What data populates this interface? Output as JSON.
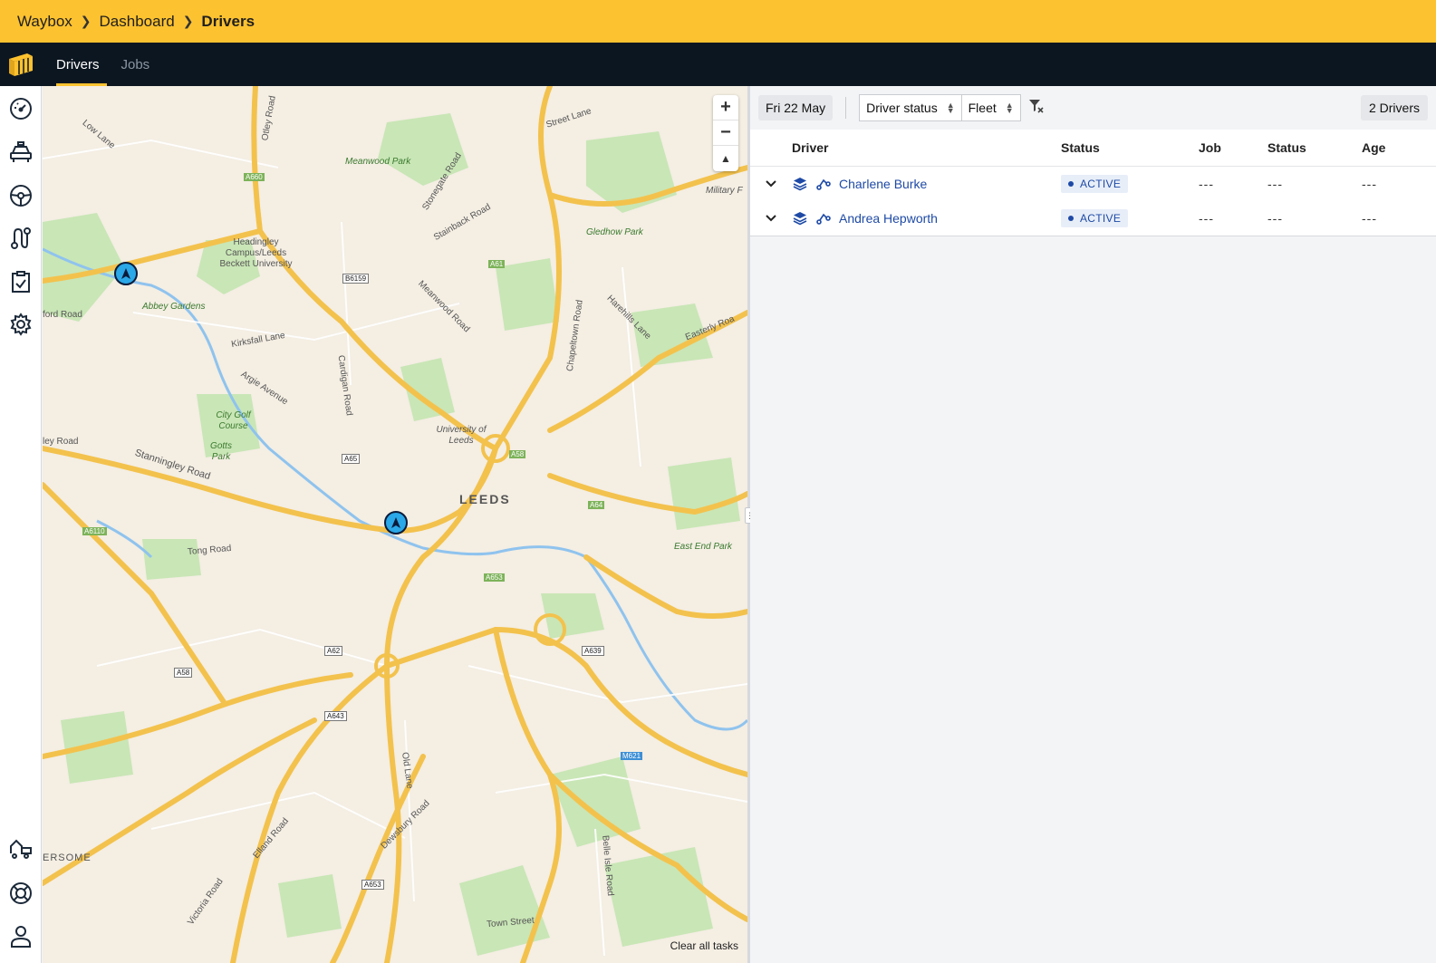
{
  "breadcrumb": {
    "items": [
      "Waybox",
      "Dashboard",
      "Drivers"
    ]
  },
  "nav": {
    "tabs": [
      {
        "label": "Drivers",
        "active": true
      },
      {
        "label": "Jobs",
        "active": false
      }
    ]
  },
  "sidebar": {
    "top_icons": [
      "speedometer-icon",
      "taxi-icon",
      "steering-wheel-icon",
      "route-icon",
      "clipboard-check-icon",
      "gear-icon"
    ],
    "bottom_icons": [
      "truck-icon",
      "lifebuoy-icon",
      "user-icon"
    ]
  },
  "map": {
    "zoom_in": "+",
    "zoom_out": "−",
    "compass": "▲",
    "clear_tasks": "Clear all tasks",
    "city_label": "LEEDS",
    "labels": {
      "otley_road": "Otley Road",
      "low_lane": "Low Lane",
      "street_lane": "Street Lane",
      "meanwood_park": "Meanwood Park",
      "stonegate_road": "Stonegate Road",
      "stainbeck_road": "Stainback Road",
      "military": "Military F",
      "gledhow_park": "Gledhow Park",
      "headingley": "Headingley Campus/Leeds Beckett University",
      "abbey_gardens": "Abbey Gardens",
      "ford_road": "ford Road",
      "kirksfall_lane": "Kirksfall Lane",
      "cardigan_road": "Cardigan Road",
      "meanwood_road": "Meanwood Road",
      "chapeltown_road": "Chapeltown Road",
      "harehills_lane": "Harehills Lane",
      "easterly_road": "Easterly Roa",
      "argie_avenue": "Argie Avenue",
      "city_golf": "City Golf Course",
      "university": "University of Leeds",
      "ley_road": "ley Road",
      "gotts_park": "Gotts Park",
      "stanningley_road": "Stanningley Road",
      "tong_road": "Tong Road",
      "east_end_park": "East End Park",
      "old_lane": "Old Lane",
      "dewsbury_road": "Dewsbury Road",
      "belle_isle": "Belle Isle Road",
      "elland_road": "Elland Road",
      "ersome": "ERSOME",
      "victoria_road": "Victoria Road",
      "town_street": "Town Street"
    },
    "shields": {
      "a660": "A660",
      "b6159": "B6159",
      "a61": "A61",
      "a65": "A65",
      "a58n": "A58",
      "a64": "A64",
      "a6110": "A6110",
      "a653": "A653",
      "a62": "A62",
      "a639": "A639",
      "a58": "A58",
      "a643": "A643",
      "m621": "M621",
      "a653s": "A653"
    }
  },
  "filters": {
    "date": "Fri 22 May",
    "driver_status": "Driver status",
    "fleet": "Fleet",
    "count": "2 Drivers"
  },
  "table": {
    "headers": {
      "driver": "Driver",
      "status": "Status",
      "job": "Job",
      "job_status": "Status",
      "age": "Age"
    },
    "rows": [
      {
        "name": "Charlene Burke",
        "status": "ACTIVE",
        "job": "---",
        "job_status": "---",
        "age": "---"
      },
      {
        "name": "Andrea Hepworth",
        "status": "ACTIVE",
        "job": "---",
        "job_status": "---",
        "age": "---"
      }
    ]
  },
  "colors": {
    "brand_yellow": "#fdc22f",
    "nav_dark": "#0c1621",
    "link_blue": "#1e4aa6",
    "marker_blue": "#2aa8e8"
  }
}
